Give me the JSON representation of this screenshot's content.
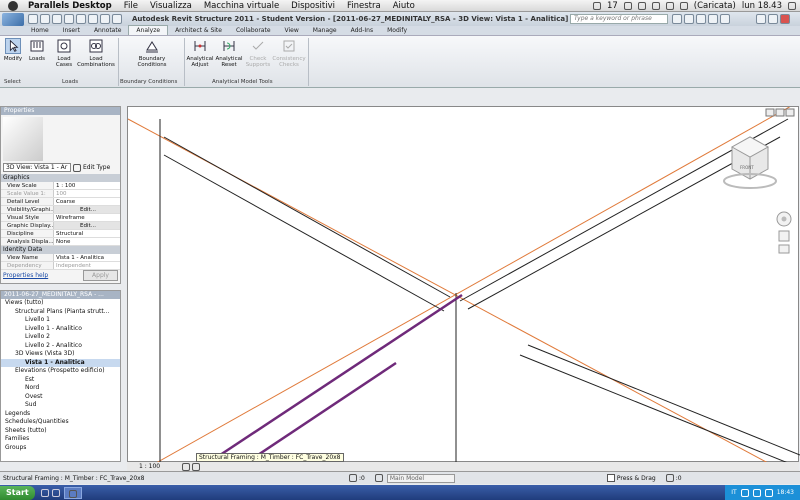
{
  "menubar": {
    "app": "Parallels Desktop",
    "items": [
      "File",
      "Visualizza",
      "Macchina virtuale",
      "Dispositivi",
      "Finestra",
      "Aiuto"
    ],
    "battery": "(Caricata)",
    "clock": "lun 18.43",
    "badge": "17"
  },
  "titlebar": {
    "title": "Autodesk Revit Structure 2011 - Student Version - [2011-06-27_MEDINITALY_RSA - 3D View: Vista 1 - Analitica]",
    "search_placeholder": "Type a keyword or phrase"
  },
  "ribbon": {
    "tabs": [
      "Home",
      "Insert",
      "Annotate",
      "Analyze",
      "Architect & Site",
      "Collaborate",
      "View",
      "Manage",
      "Add-Ins",
      "Modify"
    ],
    "active_tab": "Analyze",
    "buttons": {
      "modify": "Modify",
      "loads": "Loads",
      "load_cases": "Load Cases",
      "load_combinations": "Load Combinations",
      "boundary_conditions": "Boundary Conditions",
      "analytical_adjust": "Analytical Adjust",
      "analytical_reset": "Analytical Reset",
      "check_supports": "Check Supports",
      "consistency_checks": "Consistency Checks"
    },
    "groups": {
      "select": "Select",
      "loads": "Loads",
      "boundary": "Boundary Conditions",
      "analytical_tools": "Analytical Model Tools"
    }
  },
  "properties": {
    "title": "Properties",
    "type": "3D View: Vista 1 - Ar",
    "edit_type": "Edit Type",
    "sections": {
      "graphics": "Graphics",
      "identity": "Identity Data"
    },
    "rows": [
      {
        "k": "View Scale",
        "v": "1 : 100"
      },
      {
        "k": "Scale Value    1:",
        "v": "100"
      },
      {
        "k": "Detail Level",
        "v": "Coarse"
      },
      {
        "k": "Visibility/Graphi...",
        "v": "Edit..."
      },
      {
        "k": "Visual Style",
        "v": "Wireframe"
      },
      {
        "k": "Graphic Display...",
        "v": "Edit..."
      },
      {
        "k": "Discipline",
        "v": "Structural"
      },
      {
        "k": "Analysis Displa...",
        "v": "None"
      }
    ],
    "identity_rows": [
      {
        "k": "View Name",
        "v": "Vista 1 - Analitica"
      },
      {
        "k": "Dependency",
        "v": "Independent"
      }
    ],
    "help": "Properties help",
    "apply": "Apply"
  },
  "browser": {
    "title": "2011-06-27_MEDINITALY_RSA - ...",
    "nodes": [
      {
        "t": "Views (tutto)",
        "d": 0
      },
      {
        "t": "Structural Plans (Pianta strutt...",
        "d": 1
      },
      {
        "t": "Livello 1",
        "d": 2
      },
      {
        "t": "Livello 1 - Analitico",
        "d": 2
      },
      {
        "t": "Livello 2",
        "d": 2
      },
      {
        "t": "Livello 2 - Analitico",
        "d": 2
      },
      {
        "t": "3D Views (Vista 3D)",
        "d": 1
      },
      {
        "t": "Vista 1 - Analitica",
        "d": 2,
        "sel": true
      },
      {
        "t": "Elevations (Prospetto edificio)",
        "d": 1
      },
      {
        "t": "Est",
        "d": 2
      },
      {
        "t": "Nord",
        "d": 2
      },
      {
        "t": "Ovest",
        "d": 2
      },
      {
        "t": "Sud",
        "d": 2
      },
      {
        "t": "Legends",
        "d": 0
      },
      {
        "t": "Schedules/Quantities",
        "d": 0
      },
      {
        "t": "Sheets (tutto)",
        "d": 0
      },
      {
        "t": "Families",
        "d": 0
      },
      {
        "t": "Groups",
        "d": 0
      }
    ]
  },
  "canvas": {
    "scale": "1 : 100",
    "tooltip": "Structural Framing : M_Timber : FC_Trave_20x8",
    "viewcube_label": "FRONT"
  },
  "statusbar": {
    "text": "Structural Framing : M_Timber : FC_Trave_20x8",
    "zero": ":0",
    "model": "Main Model",
    "press_drag": "Press & Drag",
    "filter": ":0"
  },
  "taskbar": {
    "start": "Start",
    "task": "",
    "lang": "IT",
    "clock": "18:43"
  }
}
